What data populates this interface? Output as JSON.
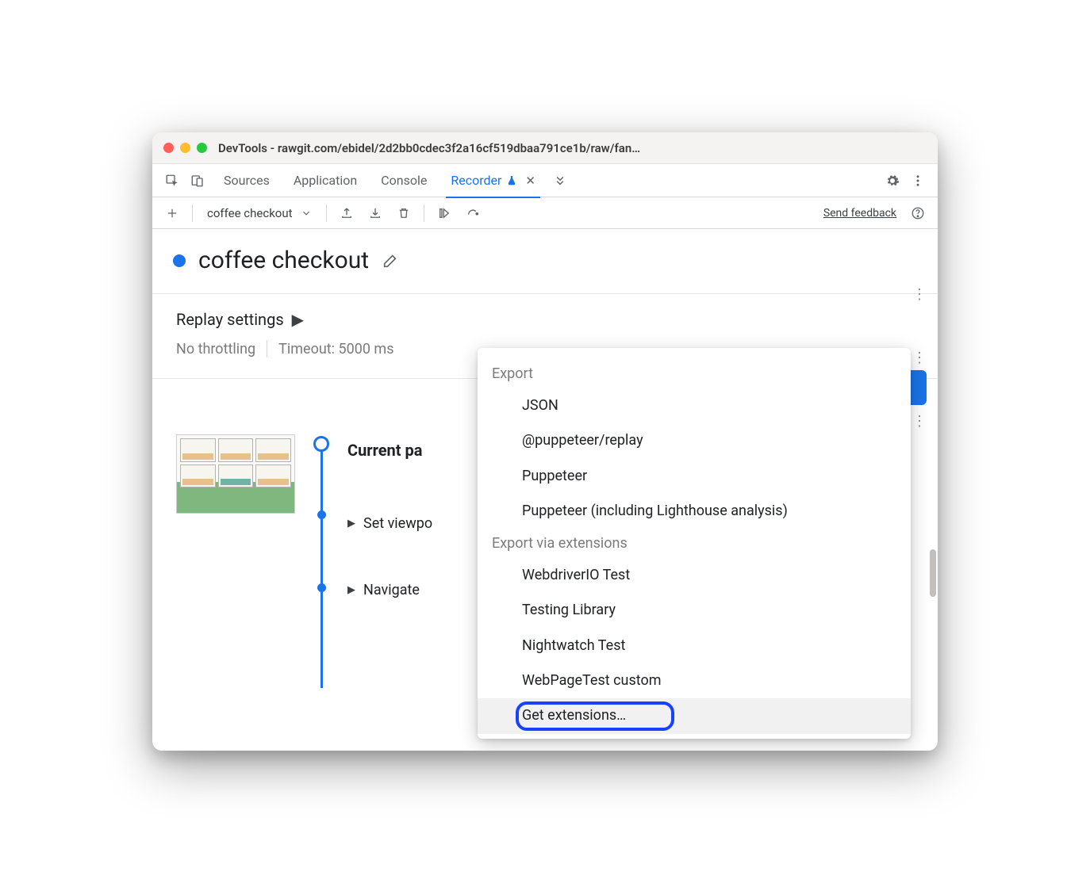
{
  "window": {
    "title": "DevTools - rawgit.com/ebidel/2d2bb0cdec3f2a16cf519dbaa791ce1b/raw/fan…"
  },
  "tabs": {
    "items": [
      "Sources",
      "Application",
      "Console",
      "Recorder"
    ],
    "active_index": 3
  },
  "toolbar": {
    "recording_name": "coffee checkout",
    "send_feedback": "Send feedback"
  },
  "recording": {
    "title": "coffee checkout",
    "replay_settings_label": "Replay settings",
    "throttling": "No throttling",
    "timeout": "Timeout: 5000 ms",
    "steps": [
      {
        "label": "Current pa",
        "bold": true
      },
      {
        "label": "Set viewpo",
        "bold": false
      },
      {
        "label": "Navigate",
        "bold": false
      }
    ]
  },
  "export_menu": {
    "section1_label": "Export",
    "section1_items": [
      "JSON",
      "@puppeteer/replay",
      "Puppeteer",
      "Puppeteer (including Lighthouse analysis)"
    ],
    "section2_label": "Export via extensions",
    "section2_items": [
      "WebdriverIO Test",
      "Testing Library",
      "Nightwatch Test",
      "WebPageTest custom",
      "Get extensions…"
    ],
    "highlighted_index": 4
  }
}
